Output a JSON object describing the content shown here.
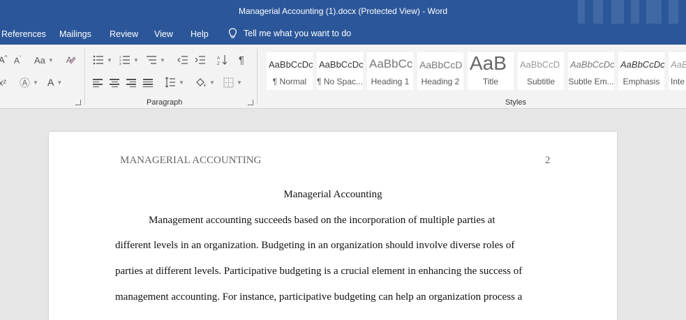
{
  "window": {
    "title": "Managerial Accounting (1).docx (Protected View)  -  Word"
  },
  "tabs": [
    {
      "label": "References"
    },
    {
      "label": "Mailings"
    },
    {
      "label": "Review"
    },
    {
      "label": "View"
    },
    {
      "label": "Help"
    }
  ],
  "tell_me": {
    "placeholder": "Tell me what you want to do"
  },
  "font_group": {
    "change_case": "Aa",
    "font_color": "A",
    "highlight": "A",
    "superscript": "x²"
  },
  "paragraph_group": {
    "label": "Paragraph",
    "pilcrow": "¶"
  },
  "styles_group": {
    "label": "Styles",
    "items": [
      {
        "preview": "AaBbCcDc",
        "name": "¶ Normal"
      },
      {
        "preview": "AaBbCcDc",
        "name": "¶ No Spac..."
      },
      {
        "preview": "AaBbCc",
        "name": "Heading 1"
      },
      {
        "preview": "AaBbCcD",
        "name": "Heading 2"
      },
      {
        "preview": "AaB",
        "name": "Title"
      },
      {
        "preview": "AaBbCcD",
        "name": "Subtitle"
      },
      {
        "preview": "AaBbCcDc",
        "name": "Subtle Em..."
      },
      {
        "preview": "AaBbCcDc",
        "name": "Emphasis"
      },
      {
        "preview": "AaBl",
        "name": "Inte"
      }
    ]
  },
  "document": {
    "header_left": "MANAGERIAL ACCOUNTING",
    "page_number": "2",
    "title": "Managerial Accounting",
    "lines": [
      "Management accounting succeeds based on the incorporation of multiple parties at",
      "different levels in an organization. Budgeting in an organization should involve diverse roles of",
      "parties at different levels. Participative budgeting is a crucial element in enhancing the success of",
      "management accounting. For instance, participative budgeting can help an organization process a"
    ]
  },
  "colors": {
    "brand": "#2b579a",
    "ribbon": "#f3f3f3",
    "canvas": "#e6e6e6"
  }
}
